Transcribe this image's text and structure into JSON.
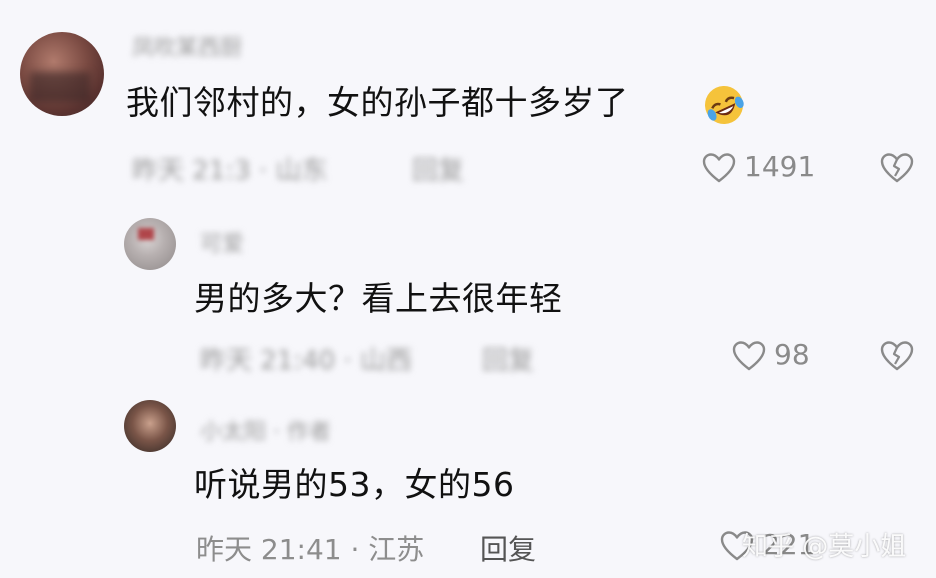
{
  "colors": {
    "background": "#f7f7fb",
    "primary_text": "#111111",
    "meta_text": "#8d8d8d",
    "icon": "#8a8a8a"
  },
  "comments": [
    {
      "username_blurred": "凤吹某西厨",
      "text": "我们邻村的，女的孙子都十多岁了",
      "emoji": "rolling-on-floor-laughing-emoji",
      "meta_blurred": "昨天 21:3 · 山东",
      "reply_blurred": "回复",
      "likes": "1491"
    },
    {
      "username_blurred": "可爱",
      "text": "男的多大？看上去很年轻",
      "meta_blurred": "昨天 21:40 · 山西",
      "reply_blurred": "回复",
      "likes": "98"
    },
    {
      "username_blurred": "小太阳 · 作者",
      "text": "听说男的53，女的56",
      "meta": "昨天 21:41 · 江苏",
      "reply": "回复",
      "likes": "221"
    }
  ],
  "watermark": "知乎 @莫小姐"
}
